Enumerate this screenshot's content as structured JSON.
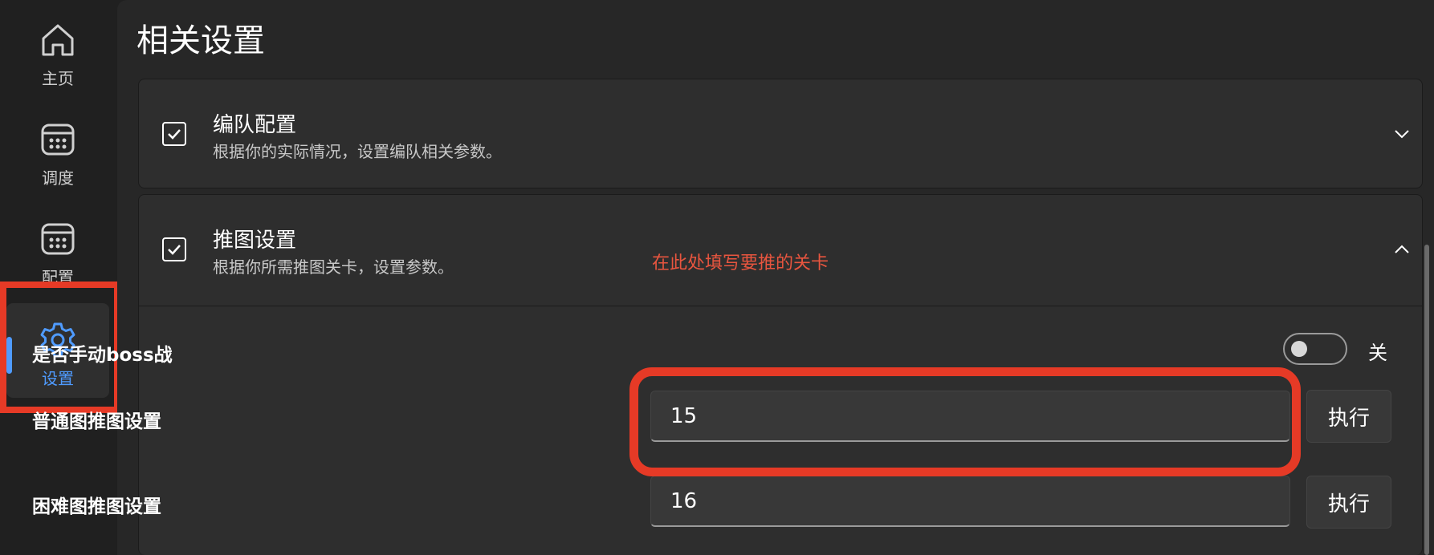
{
  "sidebar": {
    "items": [
      {
        "label": "主页",
        "icon": "home-icon"
      },
      {
        "label": "调度",
        "icon": "calendar-icon"
      },
      {
        "label": "配置",
        "icon": "calendar-icon"
      },
      {
        "label": "设置",
        "icon": "gear-icon",
        "active": true
      }
    ]
  },
  "main": {
    "title": "相关设置",
    "cards": [
      {
        "title": "编队配置",
        "description": "根据你的实际情况，设置编队相关参数。",
        "checked": true,
        "expanded": false
      },
      {
        "title": "推图设置",
        "description": "根据你所需推图关卡，设置参数。",
        "checked": true,
        "expanded": true
      }
    ],
    "push_settings": {
      "manual_boss": {
        "label": "是否手动boss战",
        "state_text": "关",
        "on": false
      },
      "normal": {
        "label": "普通图推图设置",
        "value": "15",
        "button": "执行"
      },
      "hard": {
        "label": "困难图推图设置",
        "value": "16",
        "button": "执行"
      }
    }
  },
  "annotation": {
    "hint": "在此处填写要推的关卡",
    "color": "#e63a26"
  },
  "colors": {
    "accent": "#4f9bff",
    "background": "#202020",
    "panel": "#2e2e2e"
  }
}
